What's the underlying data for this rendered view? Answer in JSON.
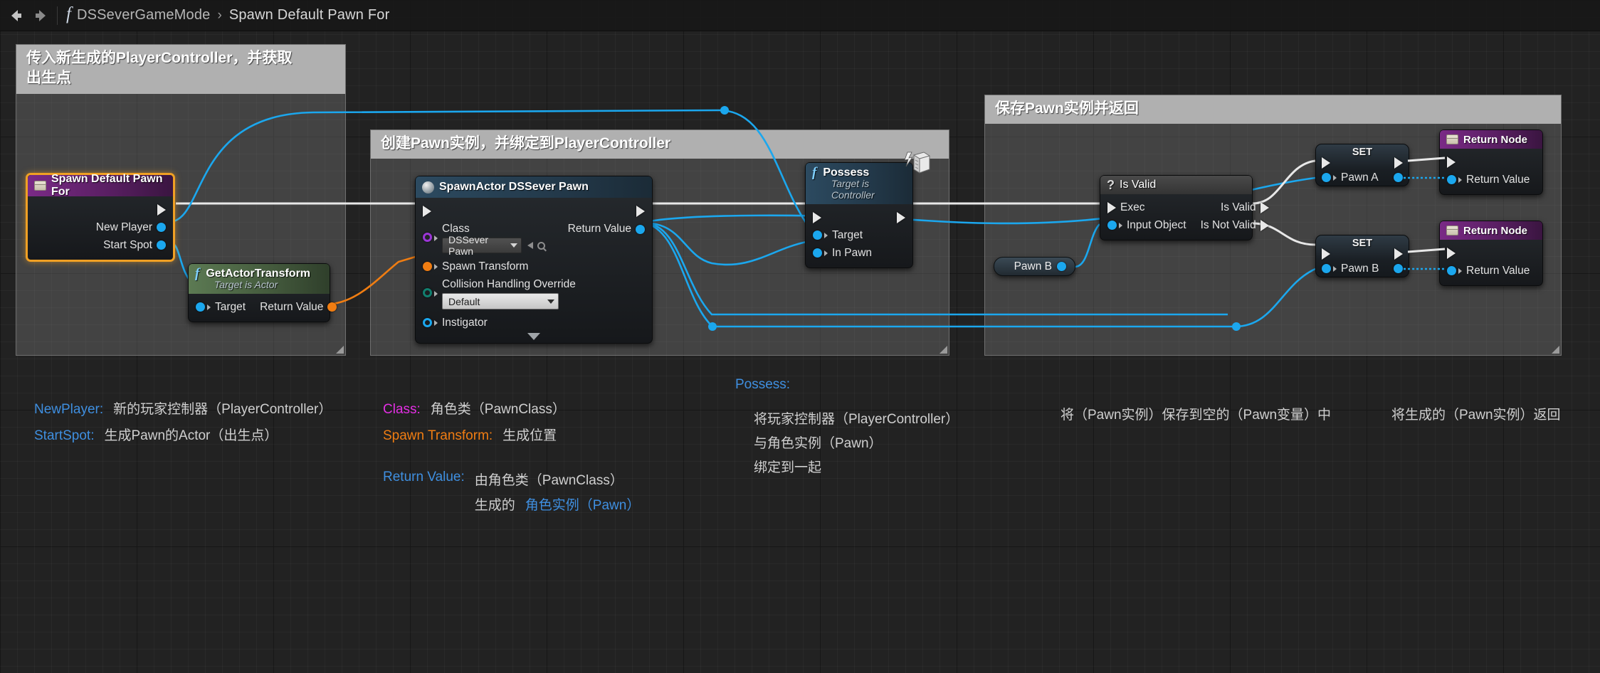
{
  "toolbar": {
    "back_icon": "back-arrow-icon",
    "forward_icon": "forward-arrow-icon",
    "function_icon": "function-fx-icon",
    "breadcrumb_root": "DSSeverGameMode",
    "breadcrumb_sep": "›",
    "breadcrumb_current": "Spawn Default Pawn For"
  },
  "comments": [
    {
      "id": "comment-input",
      "title": "传入新生成的PlayerController，并获取\n出生点"
    },
    {
      "id": "comment-spawn",
      "title": "创建Pawn实例，并绑定到PlayerController"
    },
    {
      "id": "comment-save",
      "title": "保存Pawn实例并返回"
    }
  ],
  "nodes": {
    "spawn_default_pawn_for": {
      "title": "Spawn Default Pawn For",
      "icon": "variable-box-icon",
      "out_exec": "",
      "pins_out": [
        "New Player",
        "Start Spot"
      ]
    },
    "get_actor_transform": {
      "title": "GetActorTransform",
      "subtitle": "Target is Actor",
      "icon": "function-fx-icon",
      "pin_in": "Target",
      "pin_out": "Return Value"
    },
    "spawn_actor": {
      "title": "SpawnActor DSSever Pawn",
      "icon": "spawn-actor-icon",
      "class_label": "Class",
      "class_value": "DSSever Pawn",
      "spawn_transform_label": "Spawn Transform",
      "collision_label": "Collision Handling Override",
      "collision_value": "Default",
      "instigator_label": "Instigator",
      "return_label": "Return Value",
      "expand_icon": "chevron-down-icon"
    },
    "possess": {
      "title": "Possess",
      "subtitle": "Target is Controller",
      "icon": "function-fx-icon",
      "replication_icon": "replication-server-icon",
      "pins_in": [
        "Target",
        "In Pawn"
      ]
    },
    "is_valid": {
      "title": "Is Valid",
      "icon": "question-mark-icon",
      "pins_in": [
        "Exec",
        "Input Object"
      ],
      "pins_out": [
        "Is Valid",
        "Is Not Valid"
      ]
    },
    "pawn_b_getter": {
      "label": "Pawn B"
    },
    "set_pawn_a": {
      "title": "SET",
      "pin": "Pawn A"
    },
    "set_pawn_b": {
      "title": "SET",
      "pin": "Pawn B"
    },
    "return_node_a": {
      "title": "Return Node",
      "icon": "variable-box-icon",
      "pin": "Return Value"
    },
    "return_node_b": {
      "title": "Return Node",
      "icon": "variable-box-icon",
      "pin": "Return Value"
    }
  },
  "legend": {
    "col1": [
      {
        "key": "NewPlayer:",
        "key_color": "blue",
        "value": "新的玩家控制器（PlayerController）"
      },
      {
        "key": "StartSpot:",
        "key_color": "blue",
        "value": "生成Pawn的Actor（出生点）"
      }
    ],
    "col2": [
      {
        "key": "Class:",
        "key_color": "magenta",
        "value": "角色类（PawnClass）"
      },
      {
        "key": "Spawn Transform:",
        "key_color": "orange",
        "value": "生成位置"
      }
    ],
    "col2b": {
      "key": "Return Value:",
      "key_color": "blue",
      "line1": "由角色类（PawnClass）",
      "line2_plain": "生成的",
      "line2_blue": "角色实例（Pawn）"
    },
    "col3": {
      "key": "Possess:",
      "key_color": "blue",
      "lines": [
        "将玩家控制器（PlayerController）",
        "与角色实例（Pawn）",
        "绑定到一起"
      ]
    },
    "col4": {
      "text": "将（Pawn实例）保存到空的（Pawn变量）中"
    },
    "col5": {
      "text": "将生成的（Pawn实例）返回"
    }
  },
  "colors": {
    "exec_wire": "#e8e8e8",
    "object_wire": "#1ba7ee",
    "transform_wire": "#f07d12",
    "selection": "#f0a024",
    "node_header_purple": "#7a2a86",
    "node_header_blue": "#2c4a60",
    "node_header_green": "#5c7a53",
    "background": "#222222"
  }
}
